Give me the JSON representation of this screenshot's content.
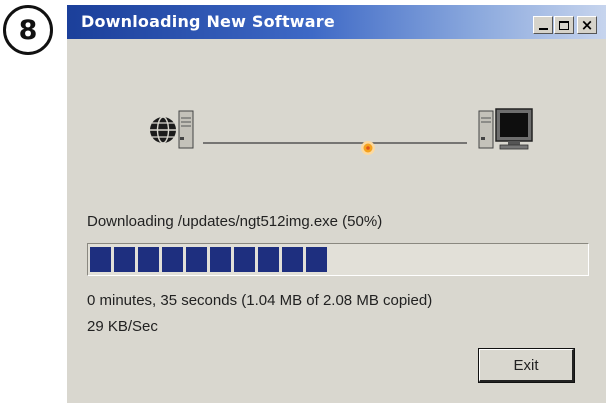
{
  "step_badge": "8",
  "window": {
    "title": "Downloading New Software",
    "close_glyph": "×"
  },
  "animation": {
    "source_icon": "globe-server-icon",
    "destination_icon": "computer-icon",
    "packet_icon": "data-packet-icon"
  },
  "status": {
    "downloading_text": "Downloading /updates/ngt512img.exe (50%)",
    "progress_fraction": 0.5,
    "time_text": "0 minutes, 35 seconds (1.04 MB of 2.08 MB copied)",
    "rate_text": "29 KB/Sec"
  },
  "buttons": {
    "exit_label": "Exit"
  },
  "colors": {
    "titlebar_start": "#1b3f9a",
    "progress_block": "#1e2f7f",
    "window_bg": "#d9d7cf",
    "packet": "#f5a21e"
  }
}
